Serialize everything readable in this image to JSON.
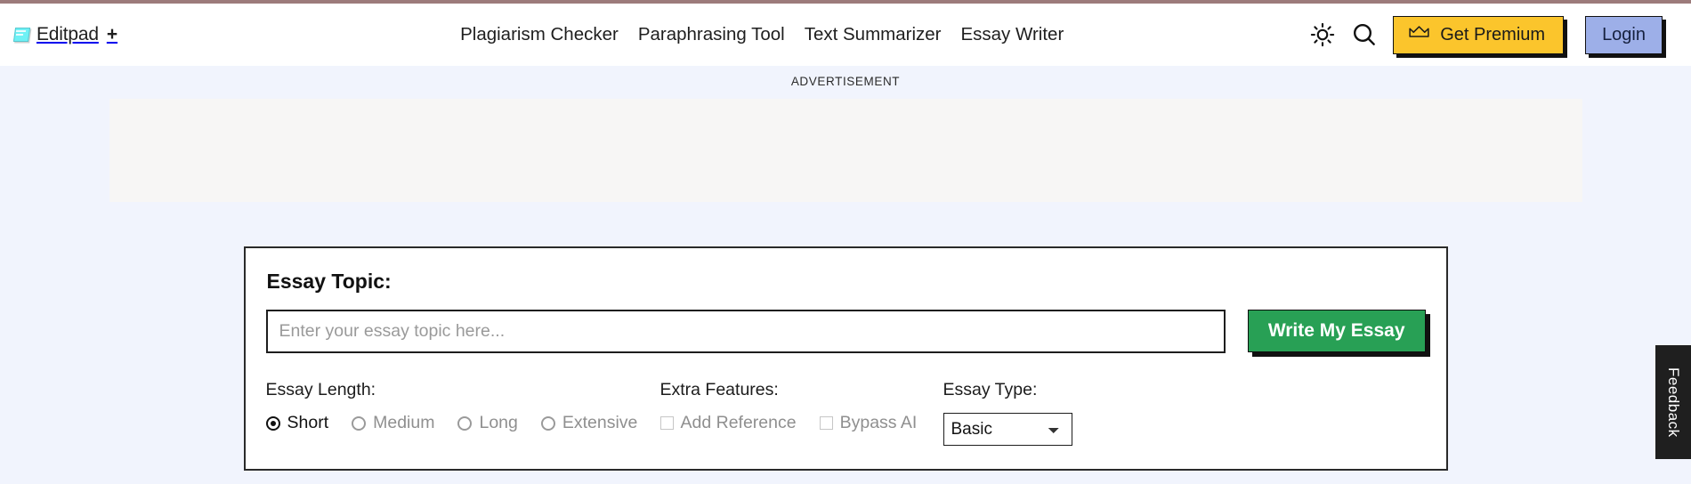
{
  "theme": {
    "page_bg": "#f1f4fd",
    "header_bg": "#ffffff",
    "top_rule": "#9c7b7b",
    "premium_yellow": "#fbc52c",
    "login_blue": "#9dafe8",
    "write_green": "#28a055",
    "panel_border": "#2a2a2a",
    "feedback_dark": "#1f1f1f"
  },
  "header": {
    "brand": {
      "icon": "notepad-icon",
      "name": "Editpad",
      "plus": "+"
    },
    "nav": [
      {
        "label": "Plagiarism Checker"
      },
      {
        "label": "Paraphrasing Tool"
      },
      {
        "label": "Text Summarizer"
      },
      {
        "label": "Essay Writer"
      }
    ],
    "actions": {
      "theme_toggle_icon": "sun-icon",
      "search_icon": "search-icon",
      "premium": {
        "icon": "crown-icon",
        "label": "Get Premium"
      },
      "login": {
        "label": "Login"
      }
    }
  },
  "advertisement": {
    "label": "ADVERTISEMENT"
  },
  "main": {
    "panel_title": "Essay Topic:",
    "topic_input": {
      "value": "",
      "placeholder": "Enter your essay topic here..."
    },
    "submit_button": {
      "label": "Write My Essay"
    },
    "essay_length": {
      "label": "Essay Length:",
      "selected": "Short",
      "options": [
        {
          "label": "Short",
          "selected": true,
          "enabled": true
        },
        {
          "label": "Medium",
          "selected": false,
          "enabled": false
        },
        {
          "label": "Long",
          "selected": false,
          "enabled": false
        },
        {
          "label": "Extensive",
          "selected": false,
          "enabled": false
        }
      ]
    },
    "extra_features": {
      "label": "Extra Features:",
      "options": [
        {
          "label": "Add Reference",
          "checked": false,
          "enabled": false
        },
        {
          "label": "Bypass AI",
          "checked": false,
          "enabled": false
        }
      ]
    },
    "essay_type": {
      "label": "Essay Type:",
      "selected": "Basic",
      "options": [
        "Basic"
      ]
    }
  },
  "feedback": {
    "label": "Feedback"
  }
}
